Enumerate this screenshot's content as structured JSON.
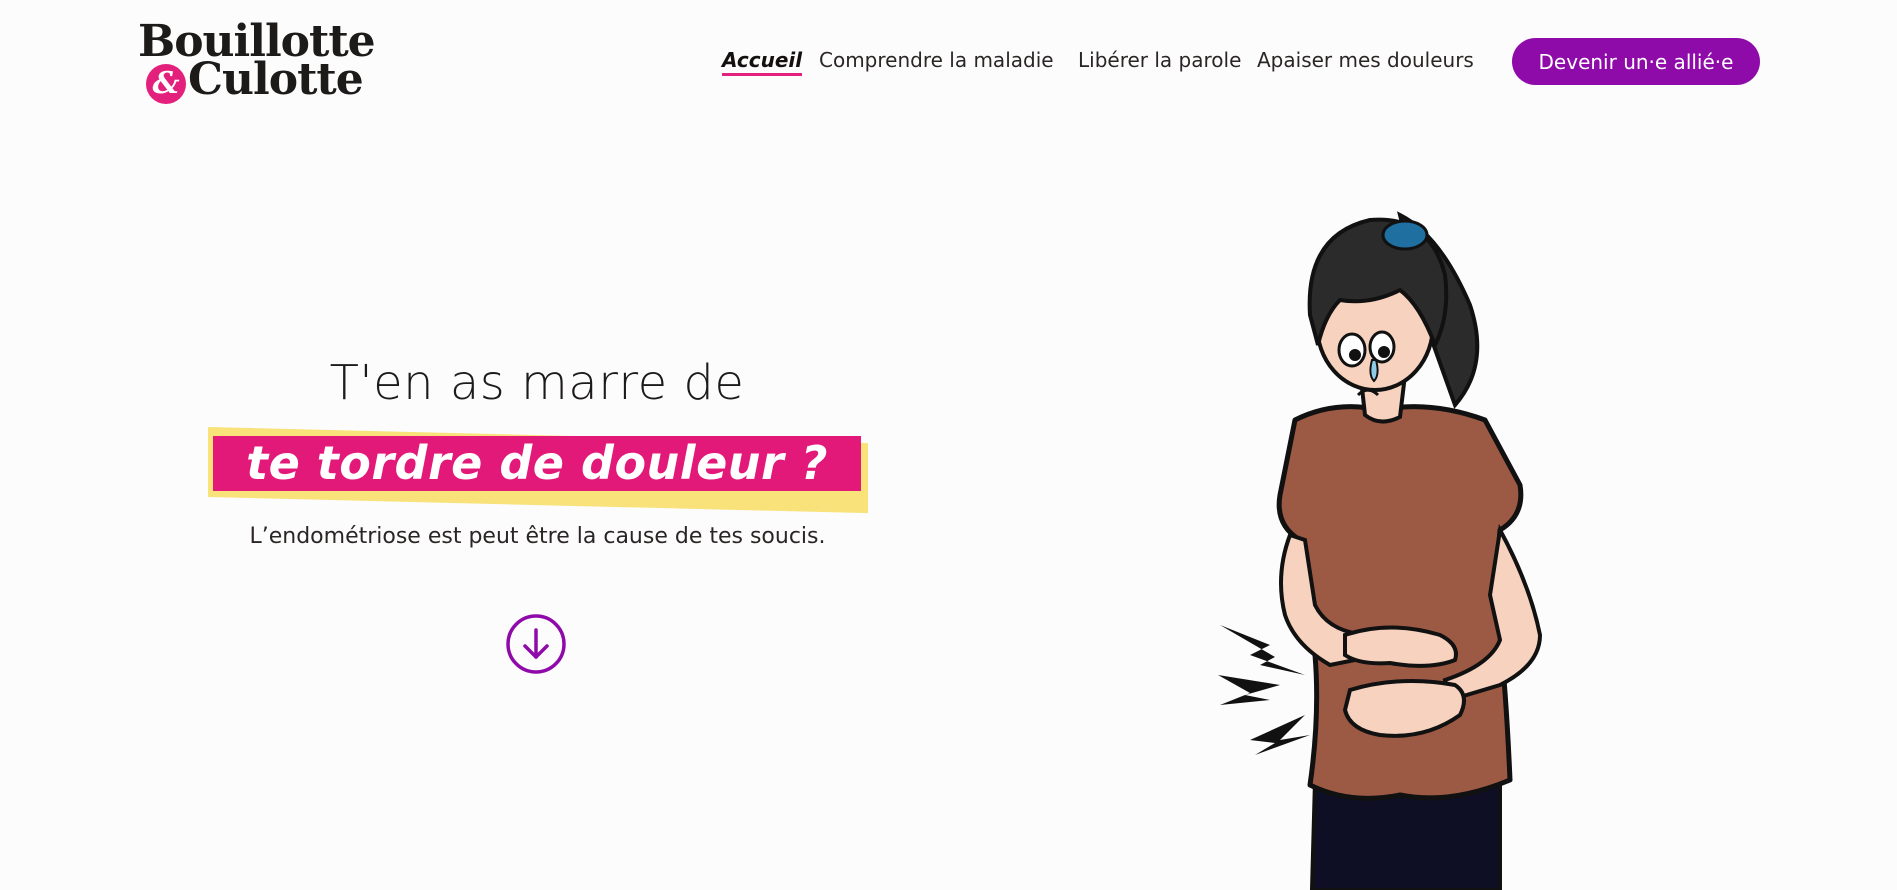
{
  "logo": {
    "line1": "Bouillotte",
    "line2": "Culotte",
    "ampersand": "&",
    "icon": "brand-logo"
  },
  "nav": {
    "items": [
      {
        "label": "Accueil",
        "active": true
      },
      {
        "label": "Comprendre la maladie",
        "active": false
      },
      {
        "label": "Libérer la parole",
        "active": false
      },
      {
        "label": "Apaiser mes douleurs",
        "active": false
      }
    ],
    "cta_label": "Devenir un·e allié·e"
  },
  "hero": {
    "title_line1": "T'en as marre de",
    "title_highlight": "te tordre de douleur ?",
    "subtitle": "L’endométriose est peut être la cause de tes soucis.",
    "scroll_icon": "arrow-down-circle-icon"
  },
  "colors": {
    "brand_pink": "#e3197a",
    "brand_purple": "#8e0aa9",
    "highlight_yellow": "#f9e27a",
    "background": "#fdfcfc",
    "text": "#1d1a1a"
  },
  "illustration": {
    "subject": "woman-stomach-pain-illustration"
  }
}
